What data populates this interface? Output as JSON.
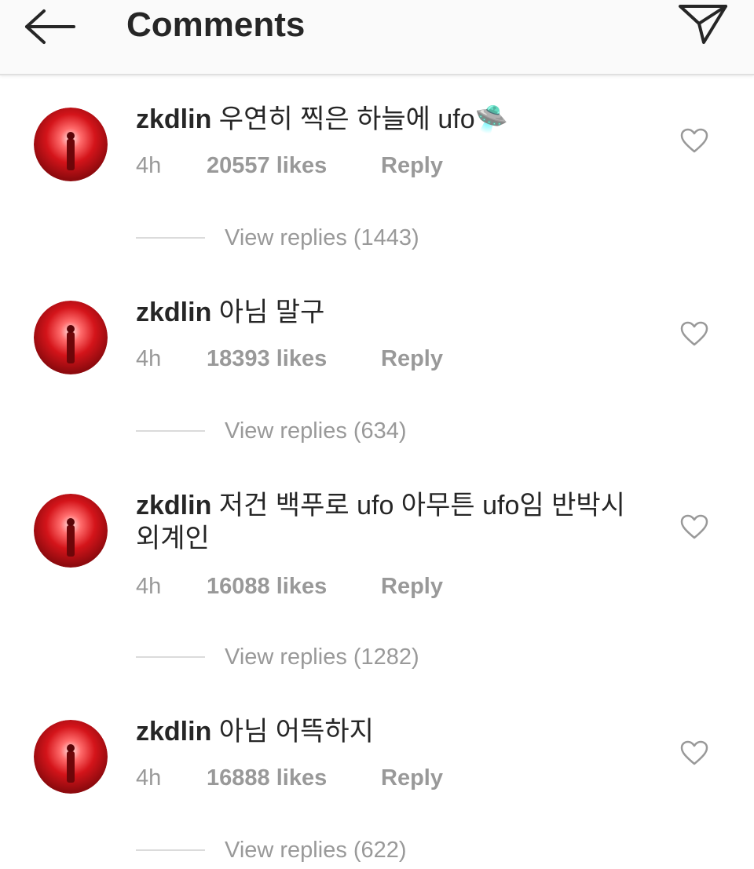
{
  "header": {
    "title": "Comments",
    "back_icon": "arrow-left-icon",
    "send_icon": "paper-plane-icon"
  },
  "colors": {
    "avatar_red": "#d4141a",
    "muted_text": "#999999",
    "primary_text": "#262626"
  },
  "comments": [
    {
      "username": "zkdlin",
      "text": "우연히 찍은 하늘에 ufo",
      "emoji": "🛸",
      "time": "4h",
      "likes": "20557 likes",
      "reply_label": "Reply",
      "view_replies": "View replies (1443)"
    },
    {
      "username": "zkdlin",
      "text": "아님 말구",
      "time": "4h",
      "likes": "18393 likes",
      "reply_label": "Reply",
      "view_replies": "View replies (634)"
    },
    {
      "username": "zkdlin",
      "text": "저건 백푸로 ufo 아무튼 ufo임 반박시 외계인",
      "time": "4h",
      "likes": "16088 likes",
      "reply_label": "Reply",
      "view_replies": "View replies (1282)"
    },
    {
      "username": "zkdlin",
      "text": "아님 어뜩하지",
      "time": "4h",
      "likes": "16888 likes",
      "reply_label": "Reply",
      "view_replies": "View replies (622)"
    }
  ]
}
